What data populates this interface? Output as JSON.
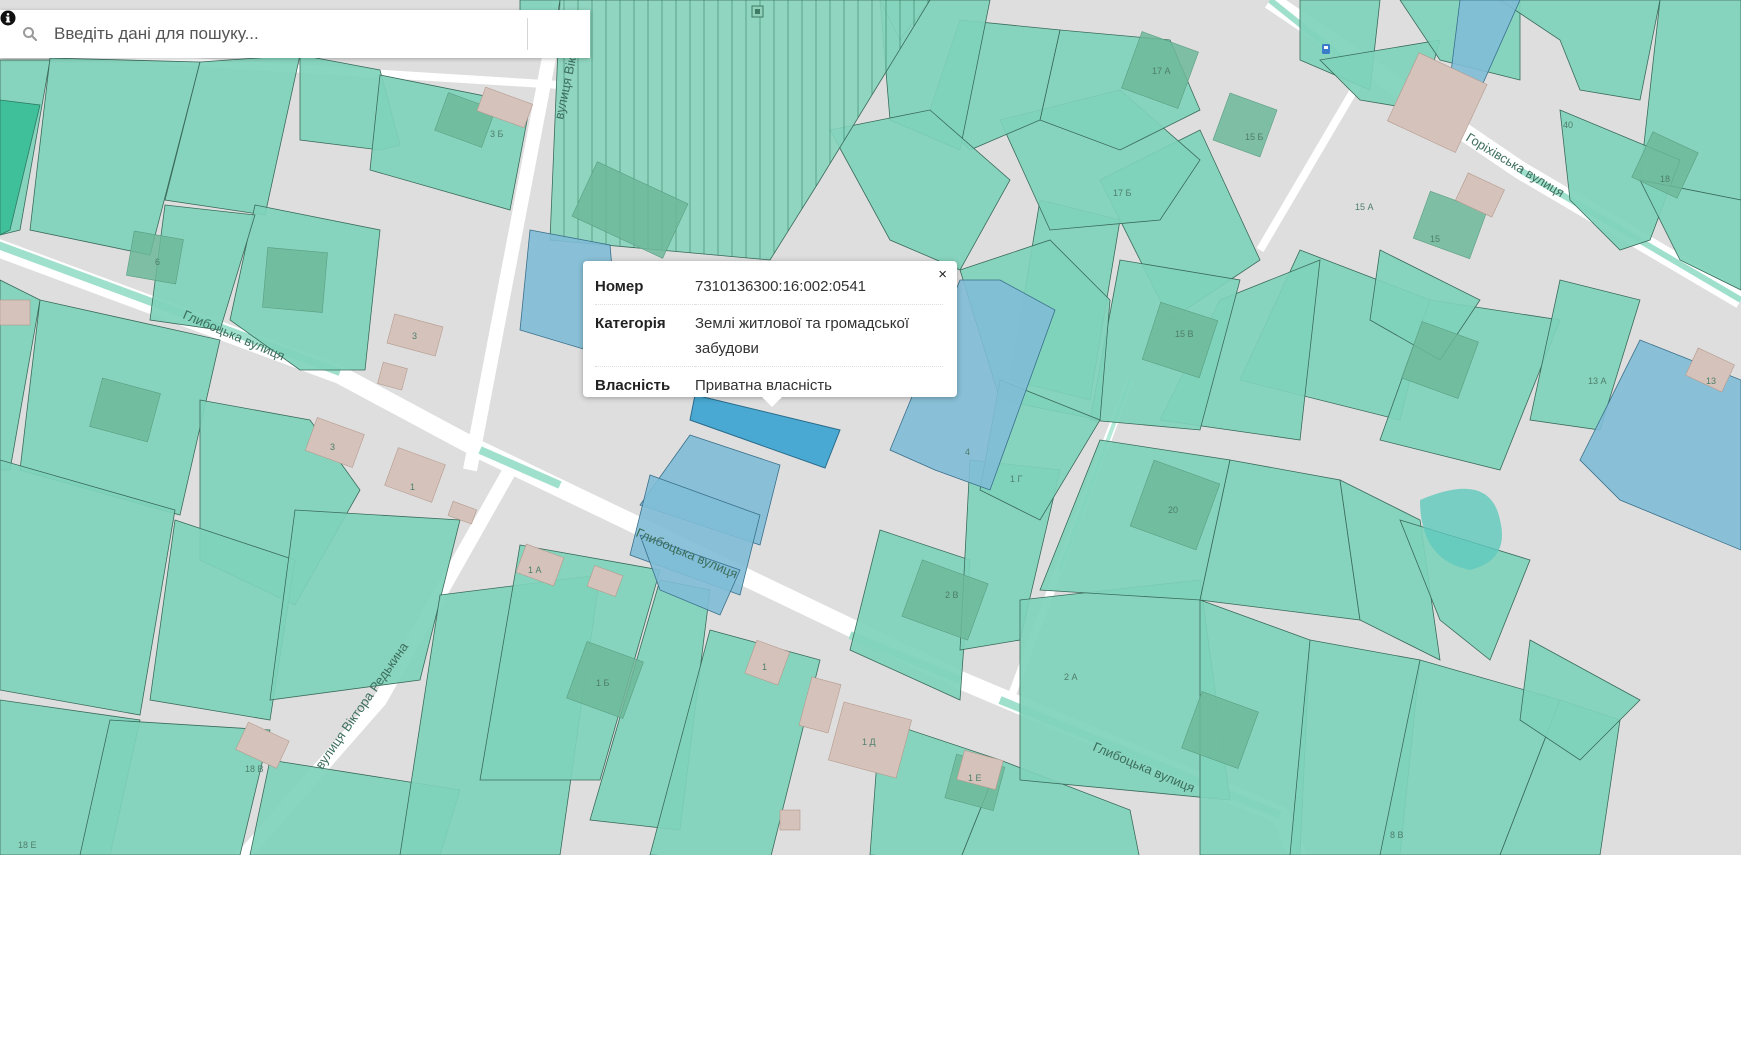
{
  "search": {
    "placeholder": "Введіть дані для пошуку...",
    "search_icon": "search-icon",
    "info_icon": "info-icon"
  },
  "popup": {
    "close_label": "×",
    "rows": [
      {
        "key": "Номер",
        "value": "7310136300:16:002:0541"
      },
      {
        "key": "Категорія",
        "value": "Землі житлової та громадської забудови"
      },
      {
        "key": "Власність",
        "value": "Приватна власність"
      }
    ]
  },
  "map": {
    "streets": {
      "hlybotska_1": "Глибоцька вулиця",
      "hlybotska_2": "Глибоцька вулиця",
      "hlybotska_3": "Глибоцька вулиця",
      "horikhivska": "Горіхівська вулиця",
      "redkina": "вулиця Віктора Редькина",
      "viktora_top": "вулиця Вікт"
    },
    "house_numbers": [
      "3",
      "3",
      "1",
      "1 А",
      "1 Б",
      "1",
      "1 Д",
      "1 Е",
      "2 А",
      "2 В",
      "4",
      "6",
      "1 Г",
      "15",
      "15 А",
      "15 Б",
      "15 В",
      "17 А",
      "17 Б",
      "20",
      "13",
      "13 А",
      "40",
      "3 Б",
      "18 В",
      "18 Е",
      "8 В",
      "18"
    ],
    "colors": {
      "parcel_green": "#7fd3bb",
      "parcel_stroke": "#3a6b5a",
      "building": "#6db89a",
      "parcel_blue": "#80bcd6",
      "parcel_selected": "#49a9d2",
      "road": "#ffffff",
      "background": "#dedede",
      "brick": "#d5c3bb"
    }
  }
}
